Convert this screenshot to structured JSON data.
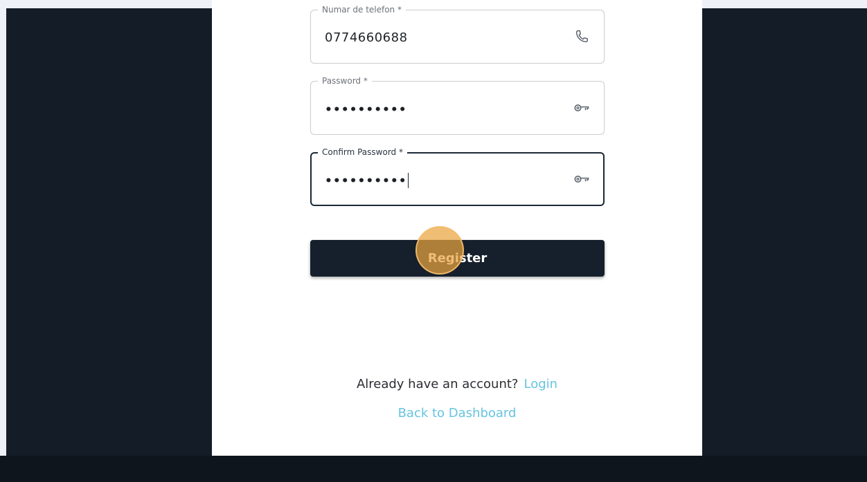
{
  "form": {
    "phone": {
      "label": "Numar de telefon *",
      "value": "0774660688",
      "icon": "phone-icon"
    },
    "password": {
      "label": "Password *",
      "value": "••••••••••",
      "icon": "key-icon"
    },
    "confirm_password": {
      "label": "Confirm Password *",
      "value": "••••••••••",
      "icon": "key-icon"
    },
    "register_label": "Register"
  },
  "footer": {
    "account_prompt": "Already have an account?",
    "login_label": "Login",
    "back_label": "Back to Dashboard"
  },
  "colors": {
    "button_bg": "#16202c",
    "link": "#66c4e0",
    "backdrop": "#131c27",
    "click_marker": "#e9a33f"
  }
}
